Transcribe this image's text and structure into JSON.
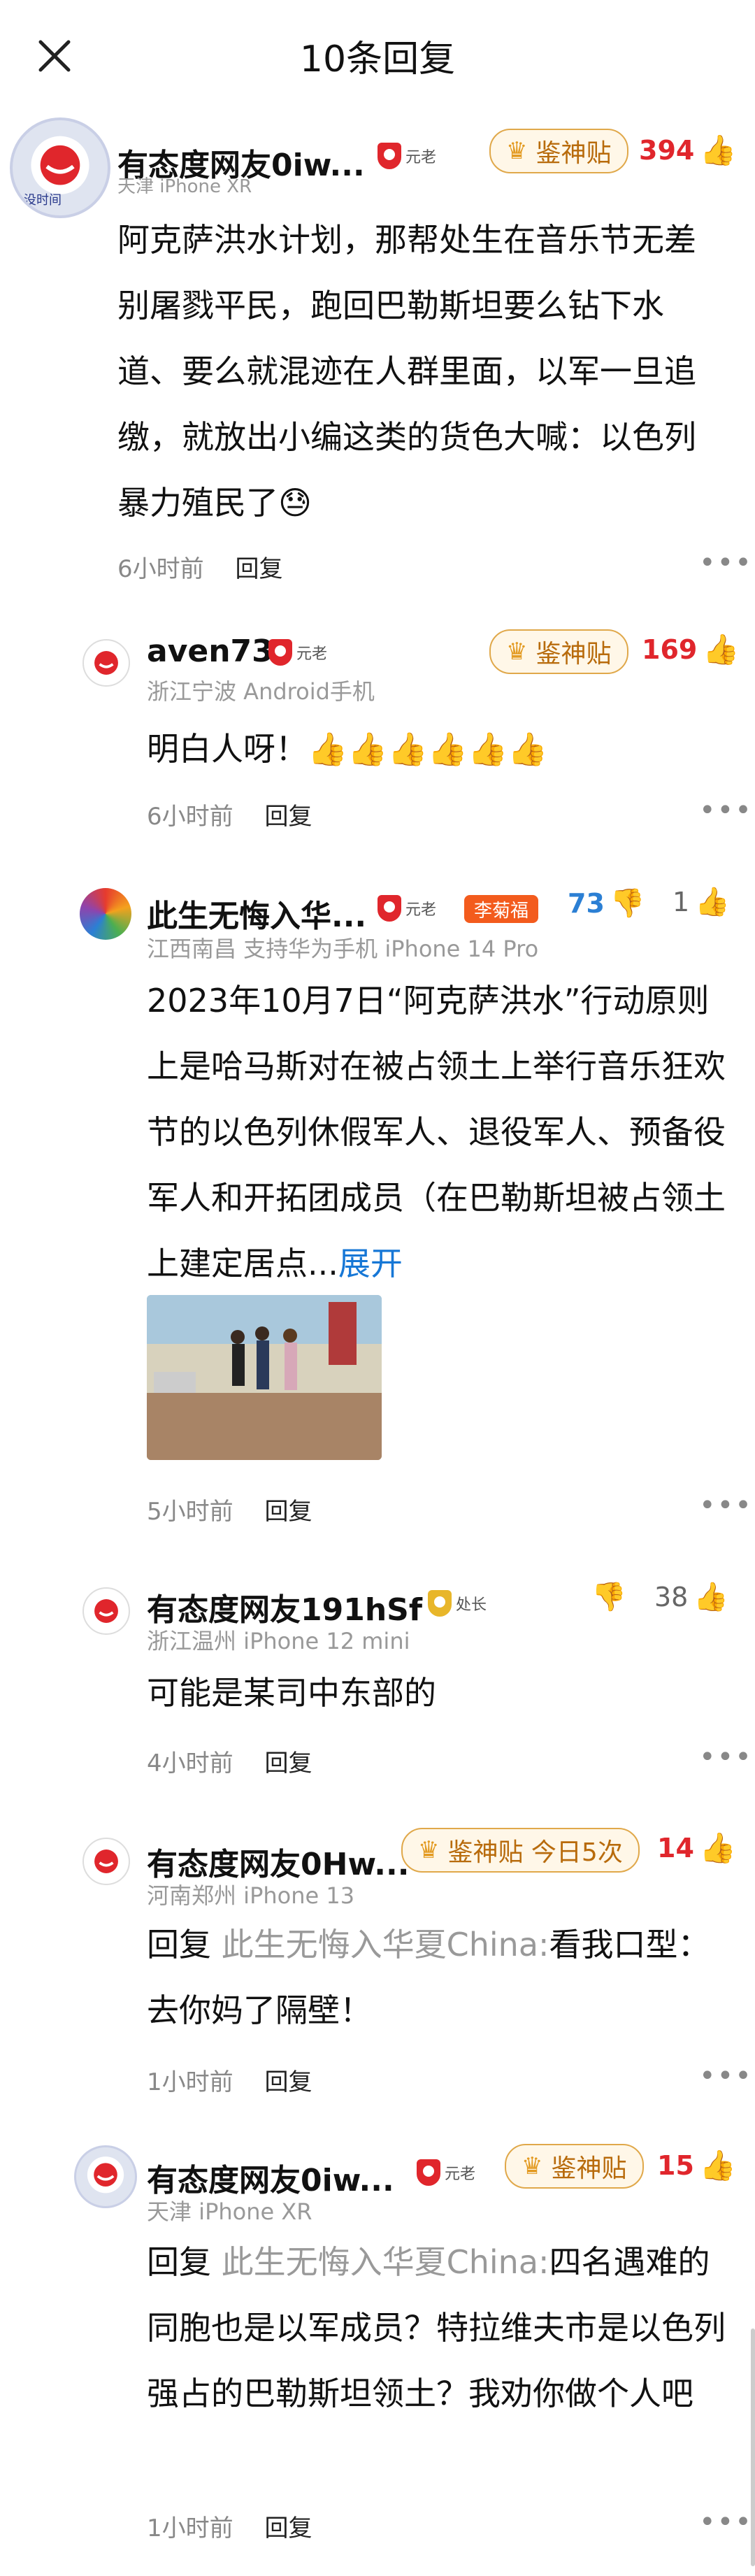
{
  "header": {
    "title": "10条回复"
  },
  "comments": [
    {
      "name": "有态度网友0iw...",
      "badge": "元老",
      "god_label": "鉴神贴",
      "likes": "394",
      "meta": "天津  iPhone XR",
      "text": "阿克萨洪水计划，那帮处生在音乐节无差别屠戮平民，跑回巴勒斯坦要么钻下水道、要么就混迹在人群里面，以军一旦追缴，就放出小编这类的货色大喊：以色列暴力殖民了😓",
      "time": "6小时前",
      "reply": "回复"
    },
    {
      "name": "aven73",
      "badge": "元老",
      "god_label": "鉴神贴",
      "likes": "169",
      "meta": "浙江宁波  Android手机",
      "text": "明白人呀！👍👍👍👍👍👍",
      "time": "6小时前",
      "reply": "回复"
    },
    {
      "name": "此生无悔入华...",
      "badge": "元老",
      "title_badge": "李菊福",
      "dislikes": "73",
      "likes": "1",
      "meta": "江西南昌  支持华为手机  iPhone 14 Pro",
      "text": "2023年10月7日“阿克萨洪水”行动原则上是哈马斯对在被占领土上举行音乐狂欢节的以色列休假军人、退役军人、预备役军人和开拓团成员（在巴勒斯坦被占领土上建定居点...",
      "expand": "展开",
      "time": "5小时前",
      "reply": "回复"
    },
    {
      "name": "有态度网友191hSf",
      "badge": "处长",
      "likes": "38",
      "meta": "浙江温州  iPhone 12 mini",
      "text": "可能是某司中东部的",
      "time": "4小时前",
      "reply": "回复"
    },
    {
      "name": "有态度网友0Hw...",
      "god_label": "鉴神贴 今日5次",
      "likes": "14",
      "meta": "河南郑州  iPhone 13",
      "reply_prefix": "回复",
      "reply_to": "此生无悔入华夏China:",
      "text": "看我口型：去你妈了隔壁！",
      "time": "1小时前",
      "reply": "回复"
    },
    {
      "name": "有态度网友0iw...",
      "badge": "元老",
      "god_label": "鉴神贴",
      "likes": "15",
      "meta": "天津  iPhone XR",
      "reply_prefix": "回复",
      "reply_to": "此生无悔入华夏China:",
      "text": "四名遇难的同胞也是以军成员？特拉维夫市是以色列强占的巴勒斯坦领土？我劝你做个人吧",
      "time": "1小时前",
      "reply": "回复"
    }
  ],
  "avatar_text": "没时间",
  "colors": {
    "accent_red": "#e0262c",
    "link_blue": "#1677d6",
    "god_gold": "#b86b0c"
  }
}
